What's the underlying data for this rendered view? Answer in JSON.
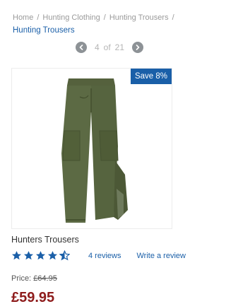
{
  "breadcrumb": {
    "items": [
      "Home",
      "Hunting Clothing",
      "Hunting Trousers"
    ],
    "separator": "/",
    "current": "Hunting Trousers"
  },
  "pager": {
    "current": "4",
    "of_label": "of",
    "total": "21",
    "prev_icon": "chevron-left-icon",
    "next_icon": "chevron-right-icon"
  },
  "badge": {
    "label": "Save 8%"
  },
  "product": {
    "title": "Hunters Trousers",
    "rating": 4.5,
    "rating_max": 5,
    "reviews_label": "4 reviews",
    "write_review_label": "Write a review",
    "was_price_label": "Price:",
    "was_price": "£64.95",
    "now_price": "£59.95"
  },
  "colors": {
    "accent": "#1a5fa8",
    "price": "#8e1c1c",
    "trousers": "#5c6a44"
  }
}
